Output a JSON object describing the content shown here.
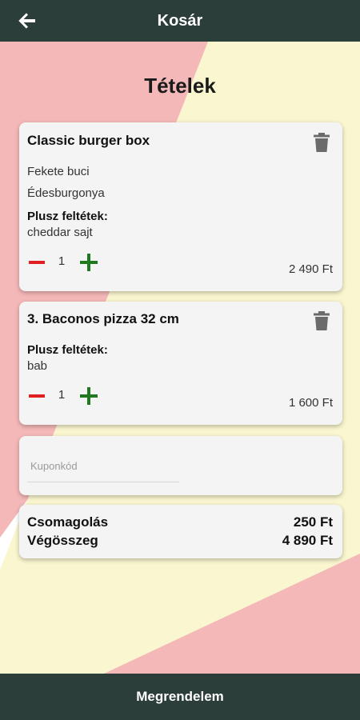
{
  "header": {
    "title": "Kosár",
    "back_icon": "arrow-left-icon"
  },
  "page": {
    "title": "Tételek"
  },
  "theme": {
    "bar_color": "#2c3e3a",
    "pink": "#f5b8b8",
    "cream": "#faf6cf",
    "minus_color": "#e02020",
    "plus_color": "#1f7a1f"
  },
  "cart": {
    "items": [
      {
        "name": "Classic burger box",
        "options": [
          "Fekete buci",
          "Édesburgonya"
        ],
        "extras_label": "Plusz feltétek:",
        "extras": "cheddar sajt",
        "quantity": "1",
        "price": "2 490 Ft"
      },
      {
        "name": "3. Baconos pizza 32 cm",
        "options": [],
        "extras_label": "Plusz feltétek:",
        "extras": "bab",
        "quantity": "1",
        "price": "1 600 Ft"
      }
    ]
  },
  "coupon": {
    "placeholder": "Kuponkód",
    "value": ""
  },
  "summary": {
    "packaging_label": "Csomagolás",
    "packaging_value": "250 Ft",
    "total_label": "Végösszeg",
    "total_value": "4 890 Ft"
  },
  "footer": {
    "order_label": "Megrendelem"
  }
}
